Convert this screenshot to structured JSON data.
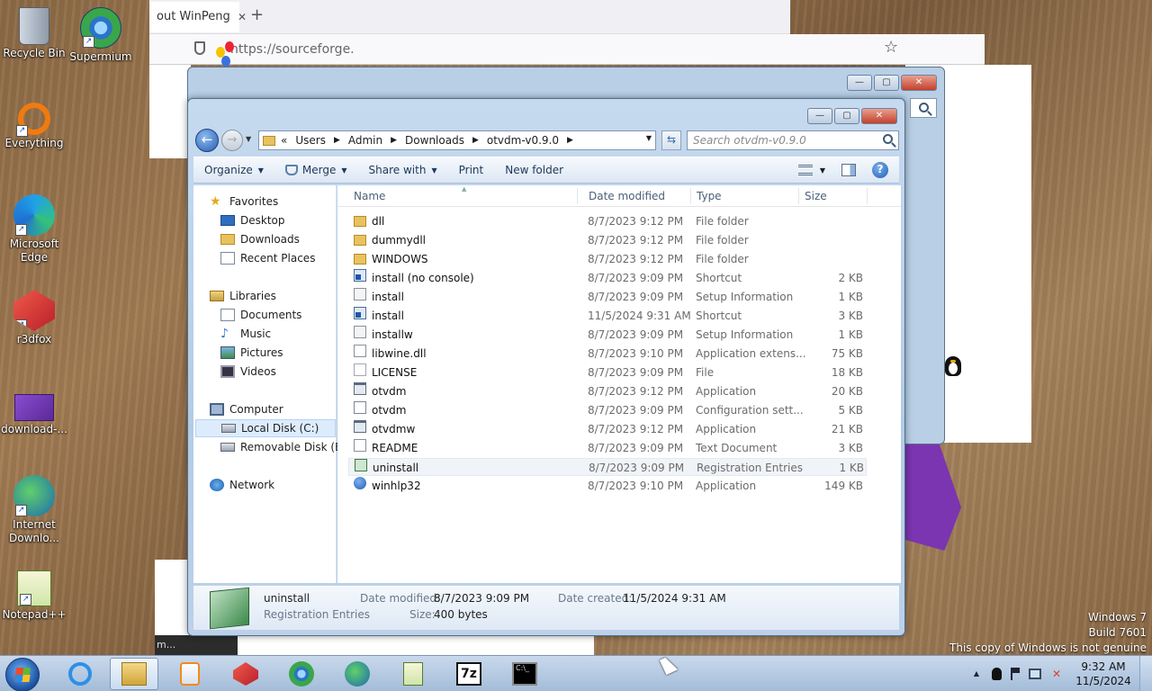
{
  "browser": {
    "tab_title": "out WinPeng",
    "new_tab": "+",
    "close_tab": "✕",
    "url": "https://sourceforge.",
    "bookmark_star": "☆",
    "footer_fragment": "m..."
  },
  "desktop": {
    "icons": [
      {
        "label": "Recycle Bin",
        "icon": "recycle-bin-icon"
      },
      {
        "label": "Supermium",
        "icon": "supermium-icon"
      },
      {
        "label": "Everything",
        "icon": "everything-icon"
      },
      {
        "label": "Microsoft Edge",
        "icon": "edge-icon"
      },
      {
        "label": "r3dfox",
        "icon": "r3dfox-icon"
      },
      {
        "label": "download-...",
        "icon": "download-icon"
      },
      {
        "label": "Internet Downlo...",
        "icon": "internet-download-manager-icon"
      },
      {
        "label": "Notepad++",
        "icon": "notepad-plus-plus-icon"
      }
    ]
  },
  "explorer": {
    "caption": {
      "minimize": "—",
      "maximize": "▢",
      "close": "✕"
    },
    "address": {
      "prefix": "«",
      "crumbs": [
        "Users",
        "Admin",
        "Downloads",
        "otvdm-v0.9.0"
      ],
      "sep": "▶"
    },
    "search_placeholder": "Search otvdm-v0.9.0",
    "commands": {
      "organize": "Organize",
      "merge": "Merge",
      "share_with": "Share with",
      "print": "Print",
      "new_folder": "New folder"
    },
    "nav": {
      "favorites": "Favorites",
      "desktop": "Desktop",
      "downloads": "Downloads",
      "recent_places": "Recent Places",
      "libraries": "Libraries",
      "documents": "Documents",
      "music": "Music",
      "pictures": "Pictures",
      "videos": "Videos",
      "computer": "Computer",
      "local_disk": "Local Disk (C:)",
      "removable_disk": "Removable Disk (E:)",
      "network": "Network"
    },
    "columns": {
      "name": "Name",
      "date": "Date modified",
      "type": "Type",
      "size": "Size"
    },
    "files": [
      {
        "name": "dll",
        "date": "8/7/2023 9:12 PM",
        "type": "File folder",
        "size": "",
        "icon": "folder"
      },
      {
        "name": "dummydll",
        "date": "8/7/2023 9:12 PM",
        "type": "File folder",
        "size": "",
        "icon": "folder"
      },
      {
        "name": "WINDOWS",
        "date": "8/7/2023 9:12 PM",
        "type": "File folder",
        "size": "",
        "icon": "folder"
      },
      {
        "name": "install (no console)",
        "date": "8/7/2023 9:09 PM",
        "type": "Shortcut",
        "size": "2 KB",
        "icon": "shortcut"
      },
      {
        "name": "install",
        "date": "8/7/2023 9:09 PM",
        "type": "Setup Information",
        "size": "1 KB",
        "icon": "setup"
      },
      {
        "name": "install",
        "date": "11/5/2024 9:31 AM",
        "type": "Shortcut",
        "size": "3 KB",
        "icon": "shortcut"
      },
      {
        "name": "installw",
        "date": "8/7/2023 9:09 PM",
        "type": "Setup Information",
        "size": "1 KB",
        "icon": "setup"
      },
      {
        "name": "libwine.dll",
        "date": "8/7/2023 9:10 PM",
        "type": "Application extens...",
        "size": "75 KB",
        "icon": "dll"
      },
      {
        "name": "LICENSE",
        "date": "8/7/2023 9:09 PM",
        "type": "File",
        "size": "18 KB",
        "icon": "file"
      },
      {
        "name": "otvdm",
        "date": "8/7/2023 9:12 PM",
        "type": "Application",
        "size": "20 KB",
        "icon": "app"
      },
      {
        "name": "otvdm",
        "date": "8/7/2023 9:09 PM",
        "type": "Configuration sett...",
        "size": "5 KB",
        "icon": "cfg"
      },
      {
        "name": "otvdmw",
        "date": "8/7/2023 9:12 PM",
        "type": "Application",
        "size": "21 KB",
        "icon": "app"
      },
      {
        "name": "README",
        "date": "8/7/2023 9:09 PM",
        "type": "Text Document",
        "size": "3 KB",
        "icon": "txt"
      },
      {
        "name": "uninstall",
        "date": "8/7/2023 9:09 PM",
        "type": "Registration Entries",
        "size": "1 KB",
        "icon": "reg"
      },
      {
        "name": "winhlp32",
        "date": "8/7/2023 9:10 PM",
        "type": "Application",
        "size": "149 KB",
        "icon": "help"
      }
    ],
    "details": {
      "name": "uninstall",
      "type": "Registration Entries",
      "date_modified_label": "Date modified:",
      "date_modified": "8/7/2023 9:09 PM",
      "date_created_label": "Date created:",
      "date_created": "11/5/2024 9:31 AM",
      "size_label": "Size:",
      "size": "400 bytes"
    }
  },
  "watermark": {
    "line1": "Windows 7",
    "line2": "Build 7601",
    "line3": "This copy of Windows is not genuine"
  },
  "taskbar": {
    "apps": [
      "ie-icon",
      "explorer-icon",
      "media-player-icon",
      "r3dfox-icon",
      "supermium-icon",
      "internet-download-manager-icon",
      "notepad-plus-plus-icon",
      "7zip-icon",
      "cmd-icon"
    ],
    "seven_zip_label": "7z",
    "cmd_label": "C:\\_",
    "tray_arrow": "▲",
    "time": "9:32 AM",
    "date": "11/5/2024"
  },
  "colors": {
    "accent": "#245fb0",
    "selection": "#ddecfd",
    "taskbar": "#b6cae2"
  }
}
